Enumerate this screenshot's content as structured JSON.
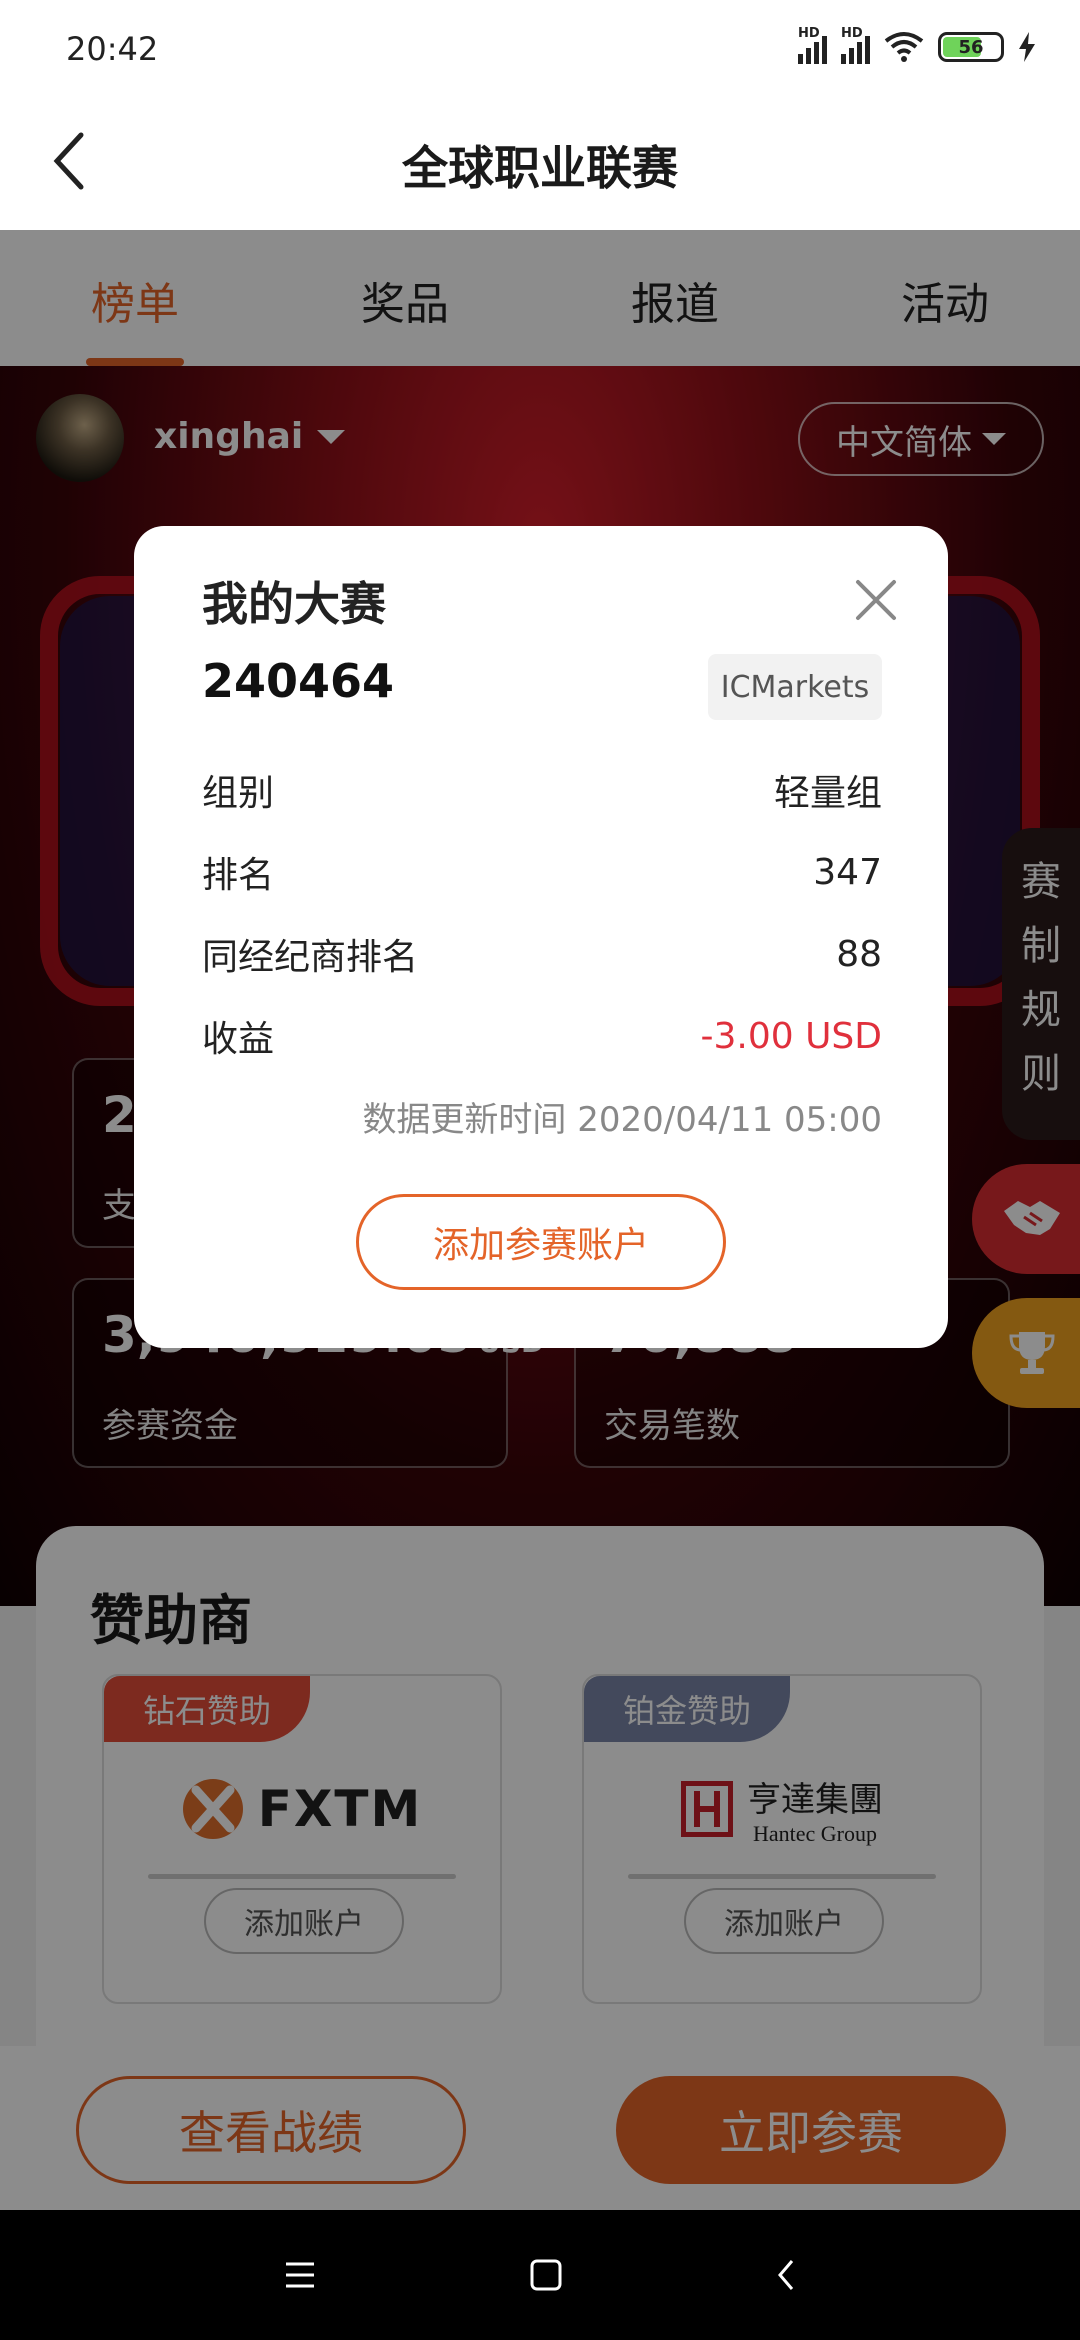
{
  "status_bar": {
    "time": "20:42",
    "signal_label_1": "HD",
    "signal_label_2": "HD",
    "battery_level": "56",
    "icons": [
      "signal-icon",
      "signal-icon",
      "wifi-icon",
      "battery-icon",
      "charging-icon"
    ]
  },
  "header": {
    "title": "全球职业联赛",
    "back_icon": "chevron-left-icon"
  },
  "tabs": [
    {
      "label": "榜单",
      "active": true
    },
    {
      "label": "奖品",
      "active": false
    },
    {
      "label": "报道",
      "active": false
    },
    {
      "label": "活动",
      "active": false
    }
  ],
  "hero": {
    "username": "xinghai",
    "language": "中文简体",
    "stats": [
      {
        "value": "2",
        "label": "支"
      },
      {
        "value": "3,940,929.05",
        "unit": "USD",
        "label": "参赛资金"
      },
      {
        "value": "70,888",
        "label": "交易笔数"
      }
    ]
  },
  "side": {
    "rules_label": "赛制规则",
    "icons": [
      "handshake-icon",
      "trophy-icon"
    ]
  },
  "sponsors": {
    "title": "赞助商",
    "items": [
      {
        "badge": "钻石赞助",
        "badge_color": "#e44d3a",
        "brand": "FXTM",
        "button": "添加账户"
      },
      {
        "badge": "铂金赞助",
        "badge_color": "#7a86a8",
        "brand_cn": "亨達集團",
        "brand_en": "Hantec Group",
        "button": "添加账户"
      }
    ]
  },
  "actions": {
    "view_record": "查看战绩",
    "join_now": "立即参赛"
  },
  "modal": {
    "title": "我的大赛",
    "account_number": "240464",
    "broker": "ICMarkets",
    "rows": [
      {
        "label": "组别",
        "value": "轻量组"
      },
      {
        "label": "排名",
        "value": "347"
      },
      {
        "label": "同经纪商排名",
        "value": "88"
      },
      {
        "label": "收益",
        "value": "-3.00 USD"
      }
    ],
    "update_time": "数据更新时间 2020/04/11 05:00",
    "add_button": "添加参赛账户"
  },
  "colors": {
    "accent": "#e46429",
    "negative": "#e0303c"
  }
}
